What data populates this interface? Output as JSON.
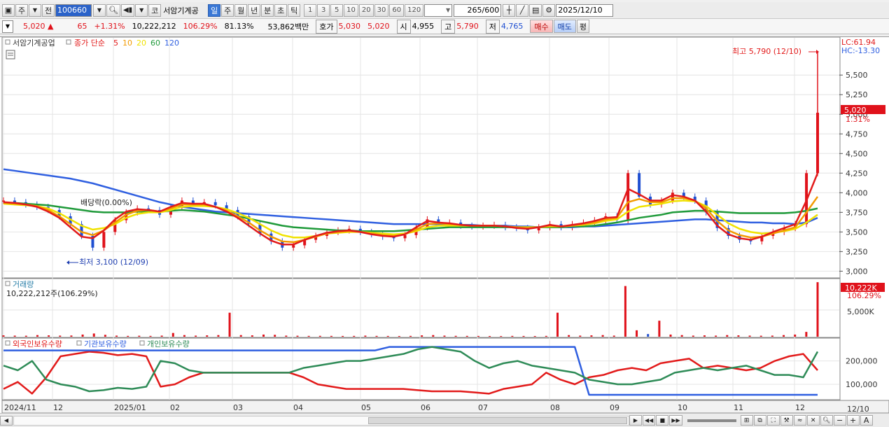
{
  "toolbar": {
    "type_btn": "주",
    "prev_btn": "전",
    "stock_code": "100660",
    "market_tag": "코",
    "stock_name": "서암기계공",
    "period_tabs": [
      "일",
      "주",
      "월",
      "년",
      "분",
      "초",
      "틱"
    ],
    "interval_values": [
      "1",
      "3",
      "5",
      "10",
      "20",
      "30",
      "60",
      "120"
    ],
    "count": "265",
    "count_total": "/600",
    "date": "2025/12/10"
  },
  "quote": {
    "price": "5,020",
    "change": "65",
    "change_pct": "+1.31%",
    "volume": "10,222,212",
    "volume_ratio": "106.29%",
    "rate": "81.13%",
    "amount": "53,862백만",
    "bid_label": "호가",
    "bid1": "5,030",
    "bid2": "5,020",
    "open_label": "시",
    "open": "4,955",
    "high_label": "고",
    "high": "5,790",
    "low_label": "저",
    "low": "4,765",
    "buy_btn": "매수",
    "sell_btn": "매도",
    "eval_btn": "평"
  },
  "price_panel": {
    "legend_name": "서암기계공업",
    "legend_type": "종가 단순",
    "ma_periods": [
      "5",
      "10",
      "20",
      "60",
      "120"
    ],
    "ma_colors": [
      "#e21a1a",
      "#f29a00",
      "#f0e200",
      "#1f9a3a",
      "#2f5fe0"
    ],
    "lc": "LC:61.94",
    "hc": "HC:-13.30",
    "max_annotation": "최고 5,790 (12/10)",
    "min_annotation": "최저 3,100 (12/09)",
    "dividend_annotation": "배당락(0.00%)",
    "current_price_label": "5,020",
    "current_pct_label": "1.31%",
    "y_ticks": [
      "5,500",
      "5,250",
      "5,000",
      "4,750",
      "4,500",
      "4,250",
      "4,000",
      "3,750",
      "3,500",
      "3,250",
      "3,000"
    ]
  },
  "volume_panel": {
    "title": "거래량",
    "value": "10,222,212주(106.29%)",
    "current_label": "10,222K",
    "current_pct": "106.29%",
    "y_tick": "5,000K"
  },
  "holding_panel": {
    "series": [
      "외국인보유수량",
      "기관보유수량",
      "개인보유수량"
    ],
    "colors": [
      "#e21a1a",
      "#2f5fe0",
      "#2e8b57"
    ],
    "y_ticks": [
      "200,000",
      "100,000"
    ]
  },
  "x_axis": {
    "labels": [
      "2024/11",
      "12",
      "2025/01",
      "02",
      "03",
      "04",
      "05",
      "06",
      "07",
      "08",
      "09",
      "10",
      "11",
      "12"
    ],
    "cursor_date": "12/10"
  },
  "chart_data": [
    {
      "type": "line",
      "ylim": [
        2950,
        5850
      ],
      "series": [
        {
          "name": "서암기계공업",
          "values": [
            3900,
            3880,
            3850,
            3820,
            3780,
            3700,
            3600,
            3450,
            3300,
            3500,
            3650,
            3750,
            3800,
            3780,
            3720,
            3820,
            3900,
            3860,
            3880,
            3840,
            3780,
            3700,
            3600,
            3480,
            3380,
            3300,
            3330,
            3400,
            3450,
            3500,
            3520,
            3540,
            3500,
            3470,
            3440,
            3420,
            3460,
            3560,
            3660,
            3620,
            3620,
            3580,
            3570,
            3580,
            3590,
            3560,
            3550,
            3520,
            3560,
            3600,
            3560,
            3600,
            3620,
            3650,
            3700,
            3650,
            4250,
            3950,
            3850,
            3900,
            4000,
            3950,
            3900,
            3750,
            3550,
            3450,
            3400,
            3380,
            3450,
            3500,
            3550,
            3600,
            4250,
            5020
          ]
        },
        {
          "name": "5",
          "values": [
            3880,
            3870,
            3850,
            3820,
            3760,
            3680,
            3560,
            3440,
            3420,
            3520,
            3660,
            3760,
            3790,
            3780,
            3760,
            3820,
            3870,
            3860,
            3860,
            3820,
            3760,
            3680,
            3580,
            3480,
            3390,
            3340,
            3340,
            3400,
            3450,
            3490,
            3510,
            3520,
            3500,
            3470,
            3450,
            3440,
            3470,
            3560,
            3640,
            3620,
            3610,
            3590,
            3580,
            3580,
            3580,
            3570,
            3550,
            3540,
            3560,
            3590,
            3570,
            3590,
            3610,
            3640,
            3680,
            3690,
            4050,
            3980,
            3900,
            3900,
            3970,
            3950,
            3900,
            3760,
            3580,
            3470,
            3420,
            3400,
            3440,
            3500,
            3550,
            3600,
            3900,
            4250
          ]
        },
        {
          "name": "10",
          "values": [
            3870,
            3860,
            3850,
            3830,
            3780,
            3700,
            3600,
            3500,
            3460,
            3520,
            3620,
            3720,
            3770,
            3780,
            3760,
            3800,
            3850,
            3850,
            3850,
            3820,
            3770,
            3700,
            3620,
            3520,
            3440,
            3380,
            3370,
            3400,
            3440,
            3480,
            3500,
            3510,
            3500,
            3480,
            3460,
            3450,
            3470,
            3530,
            3600,
            3610,
            3600,
            3590,
            3580,
            3580,
            3580,
            3570,
            3560,
            3550,
            3560,
            3580,
            3570,
            3580,
            3600,
            3620,
            3660,
            3680,
            3880,
            3920,
            3880,
            3880,
            3930,
            3930,
            3900,
            3800,
            3640,
            3520,
            3460,
            3430,
            3440,
            3480,
            3520,
            3560,
            3750,
            3950
          ]
        },
        {
          "name": "20",
          "values": [
            3860,
            3850,
            3840,
            3830,
            3800,
            3740,
            3660,
            3580,
            3530,
            3550,
            3600,
            3680,
            3730,
            3750,
            3750,
            3780,
            3820,
            3830,
            3830,
            3820,
            3790,
            3740,
            3680,
            3600,
            3520,
            3460,
            3430,
            3430,
            3450,
            3480,
            3490,
            3500,
            3500,
            3490,
            3480,
            3470,
            3480,
            3510,
            3560,
            3580,
            3580,
            3580,
            3580,
            3580,
            3580,
            3570,
            3560,
            3560,
            3560,
            3570,
            3570,
            3580,
            3590,
            3610,
            3640,
            3660,
            3760,
            3820,
            3840,
            3860,
            3890,
            3900,
            3890,
            3830,
            3720,
            3610,
            3540,
            3500,
            3480,
            3490,
            3510,
            3540,
            3620,
            3720
          ]
        },
        {
          "name": "60",
          "values": [
            3870,
            3870,
            3860,
            3850,
            3840,
            3820,
            3800,
            3780,
            3760,
            3750,
            3750,
            3750,
            3760,
            3760,
            3760,
            3770,
            3780,
            3770,
            3760,
            3740,
            3720,
            3700,
            3670,
            3640,
            3610,
            3580,
            3560,
            3550,
            3540,
            3530,
            3520,
            3520,
            3510,
            3510,
            3510,
            3510,
            3520,
            3530,
            3540,
            3550,
            3560,
            3560,
            3560,
            3560,
            3560,
            3560,
            3560,
            3560,
            3560,
            3560,
            3560,
            3570,
            3570,
            3580,
            3600,
            3620,
            3650,
            3680,
            3700,
            3720,
            3750,
            3760,
            3770,
            3770,
            3760,
            3750,
            3740,
            3740,
            3740,
            3740,
            3740,
            3750,
            3770,
            3800
          ]
        },
        {
          "name": "120",
          "values": [
            4300,
            4280,
            4260,
            4240,
            4220,
            4200,
            4180,
            4150,
            4120,
            4080,
            4040,
            4000,
            3960,
            3920,
            3880,
            3850,
            3820,
            3800,
            3780,
            3760,
            3750,
            3740,
            3730,
            3720,
            3710,
            3700,
            3690,
            3680,
            3670,
            3660,
            3650,
            3640,
            3630,
            3620,
            3610,
            3600,
            3600,
            3600,
            3600,
            3600,
            3600,
            3590,
            3590,
            3580,
            3580,
            3580,
            3570,
            3570,
            3560,
            3560,
            3560,
            3560,
            3570,
            3570,
            3580,
            3590,
            3600,
            3610,
            3620,
            3630,
            3640,
            3650,
            3660,
            3660,
            3650,
            3640,
            3630,
            3620,
            3620,
            3610,
            3610,
            3600,
            3620,
            3680
          ]
        }
      ]
    },
    {
      "type": "bar",
      "ylim": [
        0,
        10500
      ],
      "series": [
        {
          "name": "거래량",
          "values": [
            250,
            200,
            180,
            300,
            250,
            200,
            220,
            400,
            600,
            350,
            200,
            150,
            180,
            150,
            200,
            700,
            300,
            200,
            250,
            300,
            4500,
            300,
            250,
            400,
            350,
            200,
            180,
            150,
            160,
            150,
            140,
            150,
            200,
            150,
            140,
            130,
            150,
            250,
            300,
            200,
            160,
            150,
            140,
            130,
            120,
            150,
            140,
            130,
            150,
            4500,
            300,
            200,
            250,
            300,
            200,
            9500,
            1200,
            500,
            3000,
            400,
            300,
            200,
            250,
            200,
            300,
            250,
            200,
            180,
            200,
            300,
            400,
            900,
            10222
          ]
        }
      ]
    },
    {
      "type": "line",
      "ylim": [
        40000,
        280000
      ],
      "series": [
        {
          "name": "외국인보유수량",
          "values": [
            80000,
            110000,
            60000,
            130000,
            220000,
            230000,
            240000,
            235000,
            225000,
            230000,
            220000,
            90000,
            100000,
            130000,
            150000,
            150000,
            150000,
            150000,
            150000,
            150000,
            150000,
            130000,
            100000,
            90000,
            80000,
            80000,
            80000,
            80000,
            80000,
            75000,
            70000,
            70000,
            70000,
            65000,
            60000,
            80000,
            90000,
            100000,
            150000,
            120000,
            100000,
            130000,
            140000,
            160000,
            170000,
            160000,
            190000,
            200000,
            210000,
            170000,
            180000,
            170000,
            160000,
            170000,
            200000,
            220000,
            230000,
            160000
          ]
        },
        {
          "name": "기관보유수량",
          "values": [
            245000,
            245000,
            245000,
            245000,
            245000,
            245000,
            245000,
            245000,
            245000,
            245000,
            245000,
            245000,
            245000,
            245000,
            245000,
            245000,
            245000,
            245000,
            245000,
            245000,
            245000,
            245000,
            245000,
            245000,
            245000,
            245000,
            245000,
            260000,
            260000,
            260000,
            260000,
            260000,
            260000,
            260000,
            260000,
            260000,
            260000,
            260000,
            260000,
            260000,
            260000,
            55000,
            55000,
            55000,
            55000,
            55000,
            55000,
            55000,
            55000,
            55000,
            55000,
            55000,
            55000,
            55000,
            55000,
            55000,
            55000,
            55000
          ]
        },
        {
          "name": "개인보유수량",
          "values": [
            180000,
            160000,
            200000,
            120000,
            100000,
            90000,
            70000,
            75000,
            85000,
            80000,
            90000,
            200000,
            190000,
            160000,
            150000,
            150000,
            150000,
            150000,
            150000,
            150000,
            150000,
            170000,
            180000,
            190000,
            200000,
            200000,
            210000,
            220000,
            230000,
            250000,
            260000,
            250000,
            240000,
            200000,
            170000,
            190000,
            200000,
            180000,
            170000,
            160000,
            150000,
            120000,
            110000,
            100000,
            100000,
            110000,
            120000,
            150000,
            160000,
            170000,
            160000,
            170000,
            180000,
            160000,
            140000,
            140000,
            130000,
            240000
          ]
        }
      ]
    }
  ]
}
